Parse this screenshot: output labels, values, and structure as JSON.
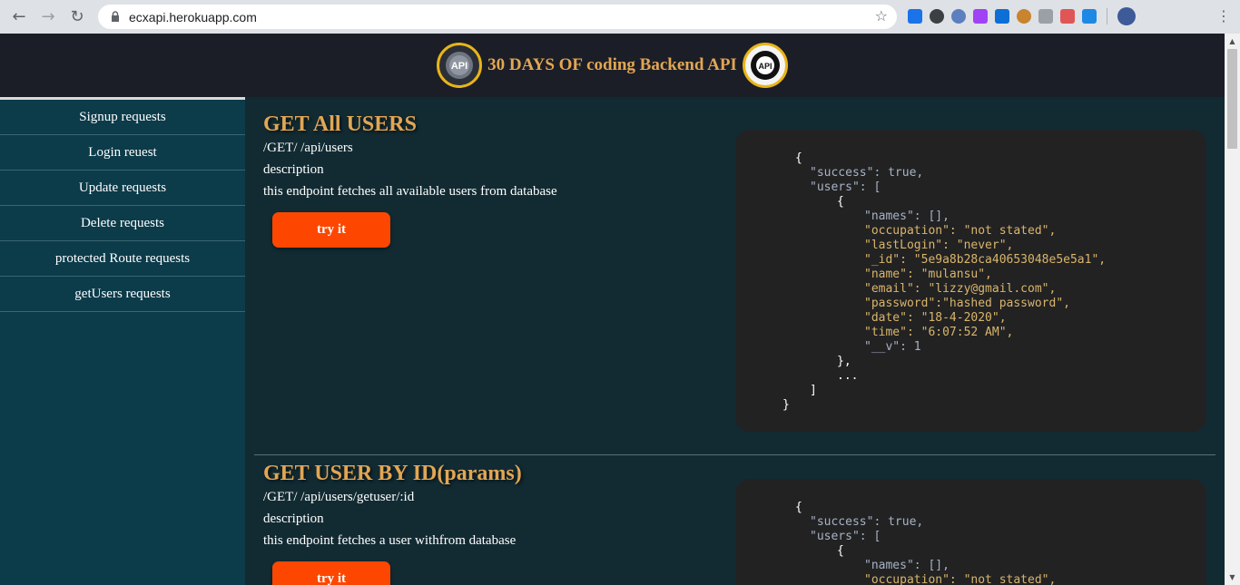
{
  "browser": {
    "url": "ecxapi.herokuapp.com",
    "back_icon": "arrow-left-icon",
    "forward_icon": "arrow-right-icon",
    "reload_icon": "reload-icon",
    "bookmark_icon": "star-icon",
    "menu_icon": "kebab-icon"
  },
  "header": {
    "title": "30 DAYS OF coding Backend API",
    "logo_left_text": "API",
    "logo_right_text": "API"
  },
  "sidebar": {
    "items": [
      {
        "label": "Signup requests"
      },
      {
        "label": "Login reuest"
      },
      {
        "label": "Update requests"
      },
      {
        "label": "Delete requests"
      },
      {
        "label": "protected Route requests"
      },
      {
        "label": "getUsers requests"
      }
    ]
  },
  "endpoints": [
    {
      "title": "GET All USERS",
      "path": "/GET/ /api/users",
      "desc_label": "description",
      "desc": "this endpoint fetches all available users from database",
      "button": "try it",
      "code_lines": [
        "{",
        "\"success\": true,",
        "\"users\": [",
        "{",
        "\"names\": [],",
        "\"occupation\": \"not stated\",",
        "\"lastLogin\": \"never\",",
        "\"_id\": \"5e9a8b28ca40653048e5e5a1\",",
        "\"name\": \"mulansu\",",
        "\"email\": \"lizzy@gmail.com\",",
        "\"password\":\"hashed password\",",
        "\"date\": \"18-4-2020\",",
        "\"time\": \"6:07:52 AM\",",
        "\"__v\": 1",
        "},",
        "...",
        "]",
        "}"
      ]
    },
    {
      "title": "GET USER BY ID(params)",
      "path": "/GET/ /api/users/getuser/:id",
      "desc_label": "description",
      "desc": "this endpoint fetches a user withfrom database",
      "button": "try it",
      "code_lines": [
        "{",
        "\"success\": true,",
        "\"users\": [",
        "{",
        "\"names\": [],",
        "\"occupation\": \"not stated\","
      ]
    }
  ],
  "colors": {
    "accent": "#e3a653",
    "button": "#fd4700",
    "sidebar": "#0c3b4a",
    "content": "#122b33",
    "header": "#1b1e26",
    "code_bg": "#222223"
  }
}
